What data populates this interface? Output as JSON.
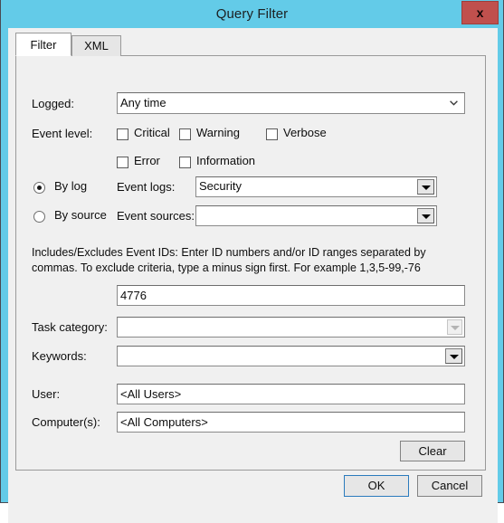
{
  "window": {
    "title": "Query Filter",
    "close_label": "x",
    "frame_color": "#63cbe8",
    "close_color": "#c0504d"
  },
  "tabs": [
    {
      "label": "Filter",
      "active": true
    },
    {
      "label": "XML",
      "active": false
    }
  ],
  "form": {
    "logged": {
      "label": "Logged:",
      "value": "Any time"
    },
    "event_level": {
      "label": "Event level:",
      "options": [
        {
          "label": "Critical",
          "checked": false
        },
        {
          "label": "Warning",
          "checked": false
        },
        {
          "label": "Verbose",
          "checked": false
        },
        {
          "label": "Error",
          "checked": false
        },
        {
          "label": "Information",
          "checked": false
        }
      ]
    },
    "source_mode": {
      "by_log_label": "By log",
      "by_source_label": "By source",
      "selected": "by_log"
    },
    "event_logs": {
      "label": "Event logs:",
      "value": "Security",
      "enabled": true
    },
    "event_sources": {
      "label": "Event sources:",
      "value": "",
      "enabled": true
    },
    "event_ids": {
      "help_text": "Includes/Excludes Event IDs: Enter ID numbers and/or ID ranges separated by commas. To exclude criteria, type a minus sign first. For example 1,3,5-99,-76",
      "value": "4776"
    },
    "task_category": {
      "label": "Task category:",
      "value": "",
      "enabled": false
    },
    "keywords": {
      "label": "Keywords:",
      "value": "",
      "enabled": true
    },
    "user": {
      "label": "User:",
      "value": "<All Users>"
    },
    "computers": {
      "label": "Computer(s):",
      "value": "<All Computers>"
    },
    "clear_label": "Clear"
  },
  "footer": {
    "ok_label": "OK",
    "cancel_label": "Cancel"
  }
}
